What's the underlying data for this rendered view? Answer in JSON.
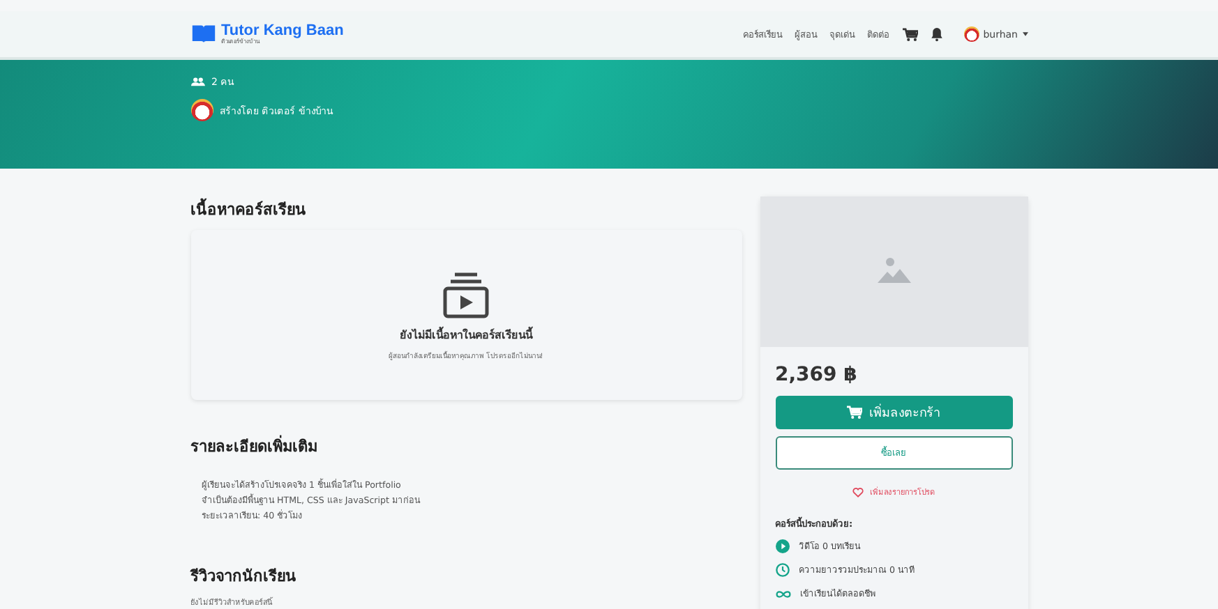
{
  "navbar": {
    "brand": "Tutor Kang Baan",
    "tagline": "ติวเตอร์ข้างบ้าน",
    "links": [
      "คอร์สเรียน",
      "ผู้สอน",
      "จุดเด่น",
      "ติดต่อ"
    ],
    "user": "burhan"
  },
  "hero": {
    "students": "2 คน",
    "creator": "สร้างโดย ติวเตอร์ ข้างบ้าน"
  },
  "content_section": {
    "title": "เนื้อหาคอร์สเรียน",
    "empty_title": "ยังไม่มีเนื้อหาในคอร์สเรียนนี้",
    "empty_text": "ผู้สอนกำลังเตรียมเนื้อหาคุณภาพ โปรดรออีกไม่นาน!"
  },
  "details": {
    "title": "รายละเอียดเพิ่มเติม",
    "lines": [
      "ผู้เรียนจะได้สร้างโปรเจคจริง 1 ชิ้นเพื่อใส่ใน Portfolio",
      "จำเป็นต้องมีพื้นฐาน HTML, CSS และ JavaScript มาก่อน",
      "ระยะเวลาเรียน: 40 ชั่วโมง"
    ]
  },
  "reviews": {
    "title": "รีวิวจากนักเรียน",
    "empty_text": "ยังไม่มีรีวิวสำหรับคอร์สนี้"
  },
  "purchase_card": {
    "price": "2,369 ฿",
    "add_to_cart": "เพิ่มลงตะกร้า",
    "buy_now": "ซื้อเลย",
    "wishlist": "เพิ่มลงรายการโปรด",
    "includes_title": "คอร์สนี้ประกอบด้วย:",
    "includes": [
      {
        "kind": "video",
        "text": "วิดีโอ 0 บทเรียน"
      },
      {
        "kind": "duration",
        "text": "ความยาวรวมประมาณ 0 นาที"
      },
      {
        "kind": "lifetime",
        "text": "เข้าเรียนได้ตลอดชีพ"
      }
    ]
  }
}
